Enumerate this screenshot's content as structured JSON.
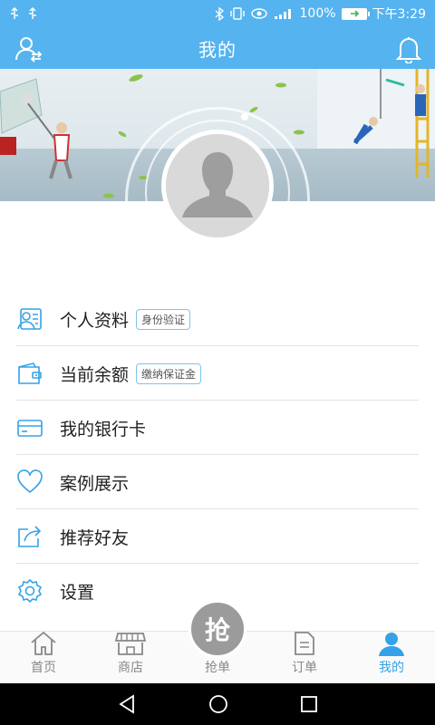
{
  "status_bar": {
    "battery": "100%",
    "time": "下午3:29",
    "icons": [
      "usb-icon",
      "usb-icon",
      "bluetooth-icon",
      "vibrate-icon",
      "eye-icon",
      "signal-icon",
      "battery-icon"
    ]
  },
  "header": {
    "title": "我的",
    "left_icon": "switch-user-icon",
    "right_icon": "bell-icon"
  },
  "menu": [
    {
      "label": "个人资料",
      "badge": "身份验证",
      "icon": "profile-card-icon"
    },
    {
      "label": "当前余额",
      "badge": "缴纳保证金",
      "icon": "wallet-icon"
    },
    {
      "label": "我的银行卡",
      "badge": "",
      "icon": "bank-card-icon"
    },
    {
      "label": "案例展示",
      "badge": "",
      "icon": "heart-icon"
    },
    {
      "label": "推荐好友",
      "badge": "",
      "icon": "share-icon"
    },
    {
      "label": "设置",
      "badge": "",
      "icon": "gear-icon"
    }
  ],
  "bottom_nav": {
    "items": [
      {
        "label": "首页",
        "icon": "home-icon"
      },
      {
        "label": "商店",
        "icon": "store-icon"
      },
      {
        "label": "抢单",
        "icon": "grab-icon"
      },
      {
        "label": "订单",
        "icon": "order-icon"
      },
      {
        "label": "我的",
        "icon": "user-icon"
      }
    ],
    "grab_symbol": "抢",
    "active_index": 4,
    "active_color": "#35a2e8"
  },
  "colors": {
    "primary": "#55b3ef",
    "accent": "#35a2e8"
  }
}
